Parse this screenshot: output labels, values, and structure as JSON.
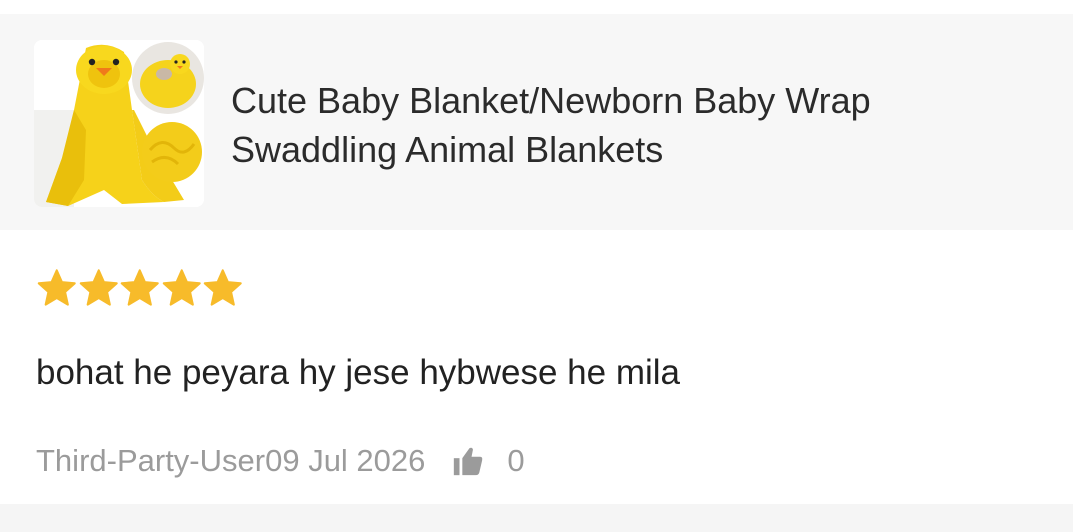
{
  "product": {
    "title_line1": "Cute Baby Blanket/Newborn Baby Wrap",
    "title_line2": "Swaddling Animal Blankets",
    "thumbnail_icon": "yellow-duck-blanket-image"
  },
  "review": {
    "rating": 5,
    "rating_max": 5,
    "star_color": "#f7bb2a",
    "text": "bohat he peyara hy jese hybwese he mila",
    "user": "Third-Party-User",
    "date": "09 Jul 2026",
    "like_icon": "thumbs-up-icon",
    "like_count": "0"
  }
}
